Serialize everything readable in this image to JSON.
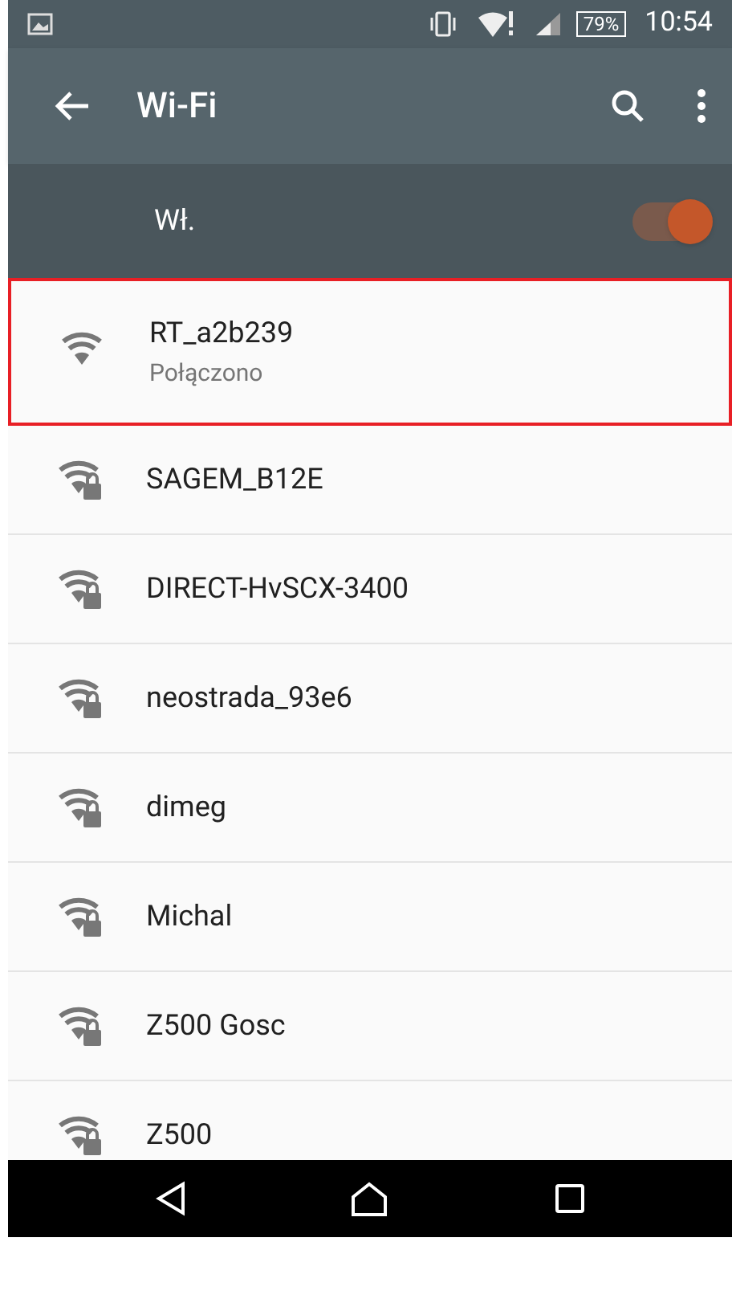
{
  "status_bar": {
    "battery": "79%",
    "time": "10:54"
  },
  "toolbar": {
    "title": "Wi-Fi"
  },
  "master_switch": {
    "label": "Wł.",
    "on": true
  },
  "networks": [
    {
      "name": "RT_a2b239",
      "status": "Połączono",
      "locked": false,
      "selected": true
    },
    {
      "name": "SAGEM_B12E",
      "locked": true,
      "selected": false
    },
    {
      "name": "DIRECT-HvSCX-3400",
      "locked": true,
      "selected": false
    },
    {
      "name": "neostrada_93e6",
      "locked": true,
      "selected": false
    },
    {
      "name": "dimeg",
      "locked": true,
      "selected": false
    },
    {
      "name": "Michal",
      "locked": true,
      "selected": false
    },
    {
      "name": "Z500 Gosc",
      "locked": true,
      "selected": false
    },
    {
      "name": "Z500",
      "locked": true,
      "selected": false
    }
  ]
}
